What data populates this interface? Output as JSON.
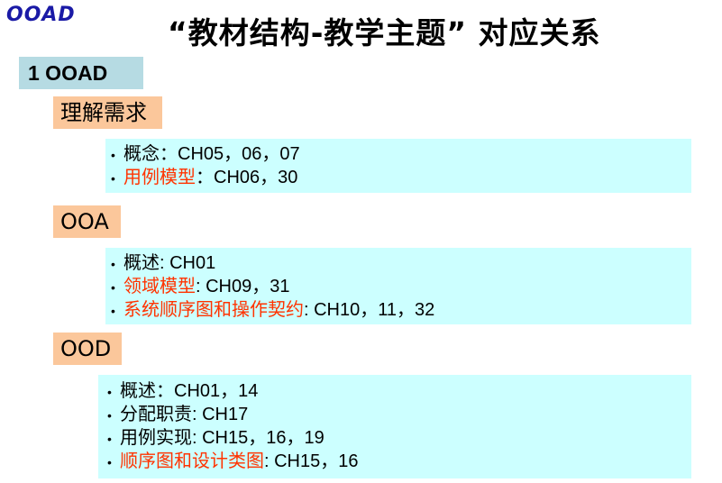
{
  "logo": "OOAD",
  "title": "“教材结构-教学主题” 对应关系",
  "section": "1 OOAD",
  "categories": [
    {
      "heading": "理解需求",
      "items": [
        {
          "highlight": "",
          "label": "概念",
          "text": "：CH05，06，07"
        },
        {
          "highlight": "用例模型",
          "label": "",
          "text": "：CH06，30"
        }
      ]
    },
    {
      "heading": "OOA",
      "items": [
        {
          "highlight": "",
          "label": "概述",
          "text": ": CH01"
        },
        {
          "highlight": "领域模型",
          "label": "",
          "text": ": CH09，31"
        },
        {
          "highlight": "系统顺序图和操作契约",
          "label": "",
          "text": ": CH10，11，32"
        }
      ]
    },
    {
      "heading": "OOD",
      "items": [
        {
          "highlight": "",
          "label": "概述",
          "text": "：CH01，14"
        },
        {
          "highlight": "",
          "label": "分配职责",
          "text": ": CH17"
        },
        {
          "highlight": "",
          "label": "用例实现",
          "text": ": CH15，16，19"
        },
        {
          "highlight": "顺序图和设计类图",
          "label": "",
          "text": ": CH15，16"
        }
      ]
    }
  ]
}
